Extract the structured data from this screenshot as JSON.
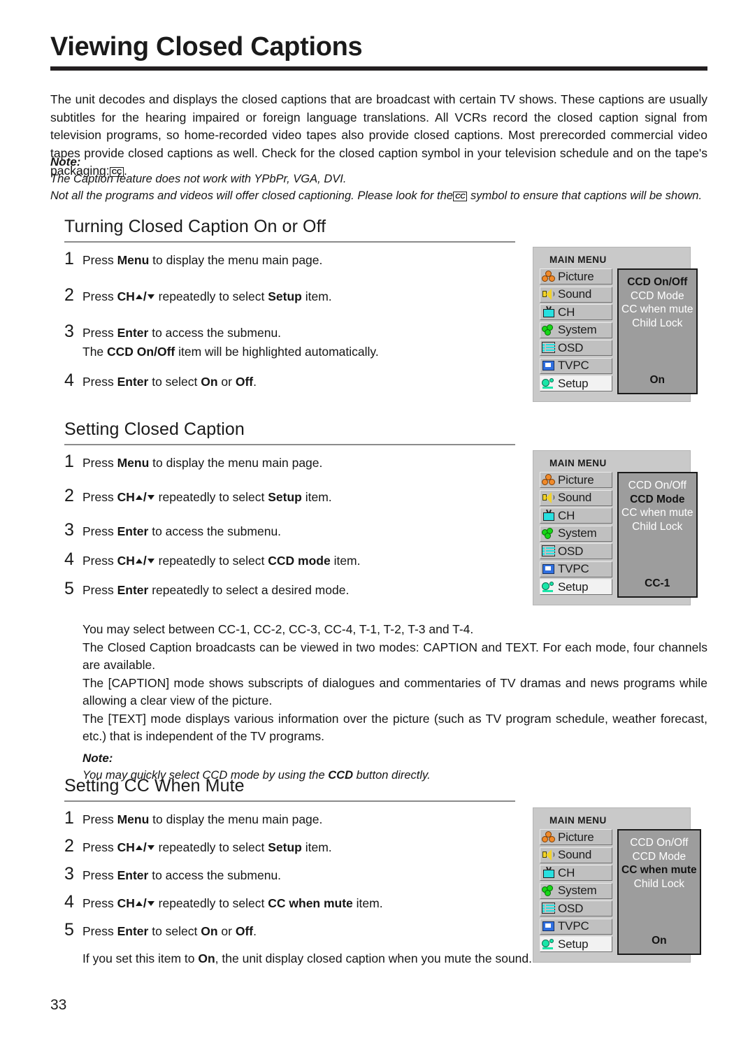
{
  "document": {
    "title": "Viewing Closed Captions",
    "page_number": "33"
  },
  "intro": {
    "part1": "The unit decodes and displays the closed captions that are broadcast with certain TV shows. These captions are usually subtitles for the hearing impaired or foreign language translations. All VCRs record the closed caption signal from television programs, so home-recorded video tapes also provide closed captions. Most prerecorded commercial video tapes provide closed captions as well. Check for the closed caption symbol in your television schedule and on the tape's packaging:",
    "cc_symbol": "CC",
    "part2": "."
  },
  "note_top": {
    "label": "Note:",
    "line1": "The Caption feature does not work with YPbPr, VGA, DVI.",
    "line2a": "Not all the programs and videos will offer closed captioning. Please look for the",
    "cc_symbol": "CC",
    "line2b": "symbol to ensure that captions will be shown."
  },
  "sections": [
    {
      "title": "Turning Closed Caption On or Off",
      "steps": [
        {
          "num": "1",
          "pre": "Press ",
          "bold1": "Menu",
          "mid": " to display the menu main page.",
          "type": "plain"
        },
        {
          "num": "2",
          "pre": "Press ",
          "bold1": "CH",
          "mid": " repeatedly to select ",
          "bold2": "Setup",
          "post": " item.",
          "type": "ch"
        },
        {
          "num": "3",
          "pre": "Press ",
          "bold1": "Enter",
          "mid": " to access the submenu.",
          "type": "plain",
          "sub_pre": "The ",
          "sub_bold": "CCD On/Off",
          "sub_post": "  item will be highlighted automatically."
        },
        {
          "num": "4",
          "pre": "Press ",
          "bold1": "Enter",
          "mid": " to select ",
          "bold2": "On",
          "midb": " or ",
          "bold3": "Off",
          "post": ".",
          "type": "onoff"
        }
      ]
    },
    {
      "title": "Setting Closed Caption",
      "steps": [
        {
          "num": "1",
          "pre": "Press ",
          "bold1": "Menu",
          "mid": " to display the menu main page.",
          "type": "plain"
        },
        {
          "num": "2",
          "pre": "Press ",
          "bold1": "CH",
          "mid": " repeatedly to select ",
          "bold2": "Setup",
          "post": " item.",
          "type": "ch"
        },
        {
          "num": "3",
          "pre": "Press ",
          "bold1": "Enter",
          "mid": " to access the submenu.",
          "type": "plain"
        },
        {
          "num": "4",
          "pre": "Press ",
          "bold1": "CH",
          "mid": " repeatedly to select ",
          "bold2": "CCD mode",
          "post": " item.",
          "type": "ch"
        },
        {
          "num": "5",
          "pre": "Press ",
          "bold1": "Enter",
          "mid": " repeatedly to select a desired mode.",
          "type": "plain"
        }
      ],
      "paragraphs": [
        "You may select between CC-1, CC-2, CC-3, CC-4, T-1, T-2, T-3 and  T-4.",
        "The Closed Caption broadcasts can be viewed in two modes: CAPTION and TEXT. For each mode, four channels are available.",
        "The [CAPTION] mode shows subscripts of dialogues and commentaries of TV dramas and news programs while allowing a clear view of the picture.",
        "The [TEXT] mode displays various information over the picture (such as TV program schedule, weather forecast, etc.) that is independent of the TV programs."
      ],
      "note": {
        "label": "Note:",
        "pre": "You may quickly select CCD mode by using the ",
        "bold": "CCD",
        "post": " button directly."
      }
    },
    {
      "title": "Setting CC When Mute",
      "steps": [
        {
          "num": "1",
          "pre": "Press ",
          "bold1": "Menu",
          "mid": " to display the menu main page.",
          "type": "plain"
        },
        {
          "num": "2",
          "pre": "Press ",
          "bold1": "CH",
          "mid": " repeatedly to select ",
          "bold2": "Setup",
          "post": " item.",
          "type": "ch"
        },
        {
          "num": "3",
          "pre": "Press ",
          "bold1": "Enter",
          "mid": " to access the submenu.",
          "type": "plain"
        },
        {
          "num": "4",
          "pre": "Press ",
          "bold1": "CH",
          "mid": " repeatedly to select ",
          "bold2": "CC when mute",
          "post": " item.",
          "type": "ch"
        },
        {
          "num": "5",
          "pre": "Press ",
          "bold1": "Enter",
          "mid": " to select ",
          "bold2": "On",
          "midb": " or ",
          "bold3": "Off",
          "post": ".",
          "type": "onoff"
        }
      ],
      "closing": {
        "pre": "If you set this item to ",
        "bold": "On",
        "post": ", the unit display closed caption when you mute the sound."
      }
    }
  ],
  "osd": {
    "header": "MAIN MENU",
    "menu_items": [
      {
        "label": "Picture",
        "icon": "picture-icon",
        "selected": false
      },
      {
        "label": "Sound",
        "icon": "sound-icon",
        "selected": false
      },
      {
        "label": "CH",
        "icon": "tv-icon",
        "selected": false
      },
      {
        "label": "System",
        "icon": "gears-icon",
        "selected": false
      },
      {
        "label": "OSD",
        "icon": "osd-lines-icon",
        "selected": false
      },
      {
        "label": "TVPC",
        "icon": "monitor-icon",
        "selected": false
      },
      {
        "label": "Setup",
        "icon": "setup-icon",
        "selected": true
      }
    ],
    "submenu_items": [
      "CCD On/Off",
      "CCD Mode",
      "CC when mute",
      "Child Lock"
    ],
    "panels": [
      {
        "highlighted": "CCD On/Off",
        "value": "On"
      },
      {
        "highlighted": "CCD Mode",
        "value": "CC-1"
      },
      {
        "highlighted": "CC when mute",
        "value": "On"
      }
    ]
  },
  "colors": {
    "title_rule": "#231f20",
    "section_rule": "#8b8b8b",
    "osd_bg": "#c9c9c9",
    "osd_row": "#c0c0c0",
    "osd_row_selected": "#f2f2f2",
    "submenu_bg": "#9d9d9d",
    "icon_picture": "#f08a2a",
    "icon_sound": "#f2d32a",
    "icon_ch": "#27e0e0",
    "icon_system": "#17d617",
    "icon_osd": "#27e0e0",
    "icon_tvpc": "#2f6fe0",
    "icon_setup": "#19e6a8"
  }
}
